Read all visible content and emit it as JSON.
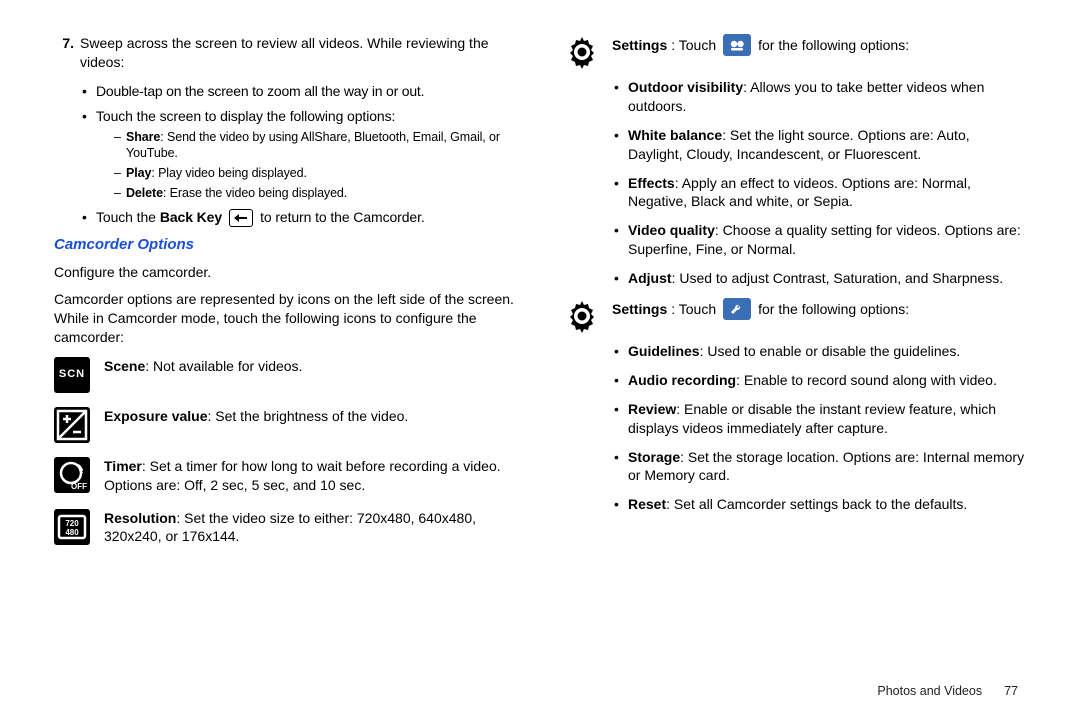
{
  "left": {
    "step_num": "7.",
    "step_text": "Sweep across the screen to review all videos. While reviewing the videos:",
    "b1a": "Double-tap on the screen to zoom all the way in or out.",
    "b1b": "Touch the screen to display the following options:",
    "d2a_bold": "Share",
    "d2a_rest": ": Send the video by using AllShare, Bluetooth, Email, Gmail, or YouTube.",
    "d2b_bold": "Play",
    "d2b_rest": ": Play video being displayed.",
    "d2c_bold": "Delete",
    "d2c_rest": ": Erase the video being displayed.",
    "b1c_pre": "Touch the ",
    "b1c_bold": "Back Key",
    "b1c_post": " to return to the Camcorder.",
    "heading": "Camcorder Options",
    "par1": "Configure the camcorder.",
    "par2": "Camcorder options are represented by icons on the left side of the screen. While in Camcorder mode, touch the following icons to configure the camcorder:",
    "row_scene_bold": "Scene",
    "row_scene_rest": ": Not available for videos.",
    "row_ev_bold": "Exposure value",
    "row_ev_rest": ": Set the brightness of the video.",
    "row_timer_bold": "Timer",
    "row_timer_rest": ": Set a timer for how long to wait before recording a video. Options are: Off, 2 sec, 5 sec, and 10 sec.",
    "row_res_bold": "Resolution",
    "row_res_rest": ": Set the video size to either: 720x480, 640x480, 320x240, or 176x144."
  },
  "right": {
    "set1_bold": "Settings",
    "set1_pre": ": Touch ",
    "set1_post": " for the following options:",
    "g1a_bold": "Outdoor visibility",
    "g1a_rest": ": Allows you to take better videos when outdoors.",
    "g1b_bold": "White balance",
    "g1b_rest": ": Set the light source. Options are: Auto, Daylight, Cloudy, Incandescent, or Fluorescent.",
    "g1c_bold": "Effects",
    "g1c_rest": ": Apply an effect to videos. Options are: Normal, Negative, Black and white, or Sepia.",
    "g1d_bold": "Video quality",
    "g1d_rest": ": Choose a quality setting for videos. Options are: Superfine, Fine, or Normal.",
    "g1e_bold": "Adjust",
    "g1e_rest": ": Used to adjust Contrast, Saturation, and Sharpness.",
    "set2_bold": "Settings",
    "set2_pre": ": Touch ",
    "set2_post": " for the following options:",
    "g2a_bold": "Guidelines",
    "g2a_rest": ": Used to enable or disable the guidelines.",
    "g2b_bold": "Audio recording",
    "g2b_rest": ": Enable to record sound along with video.",
    "g2c_bold": "Review",
    "g2c_rest": ": Enable or disable the instant review feature, which displays videos immediately after capture.",
    "g2d_bold": "Storage",
    "g2d_rest": ": Set the storage location. Options are: Internal memory or Memory card.",
    "g2e_bold": "Reset",
    "g2e_rest": ": Set all Camcorder settings back to the defaults."
  },
  "footer": {
    "section": "Photos and Videos",
    "page": "77"
  }
}
